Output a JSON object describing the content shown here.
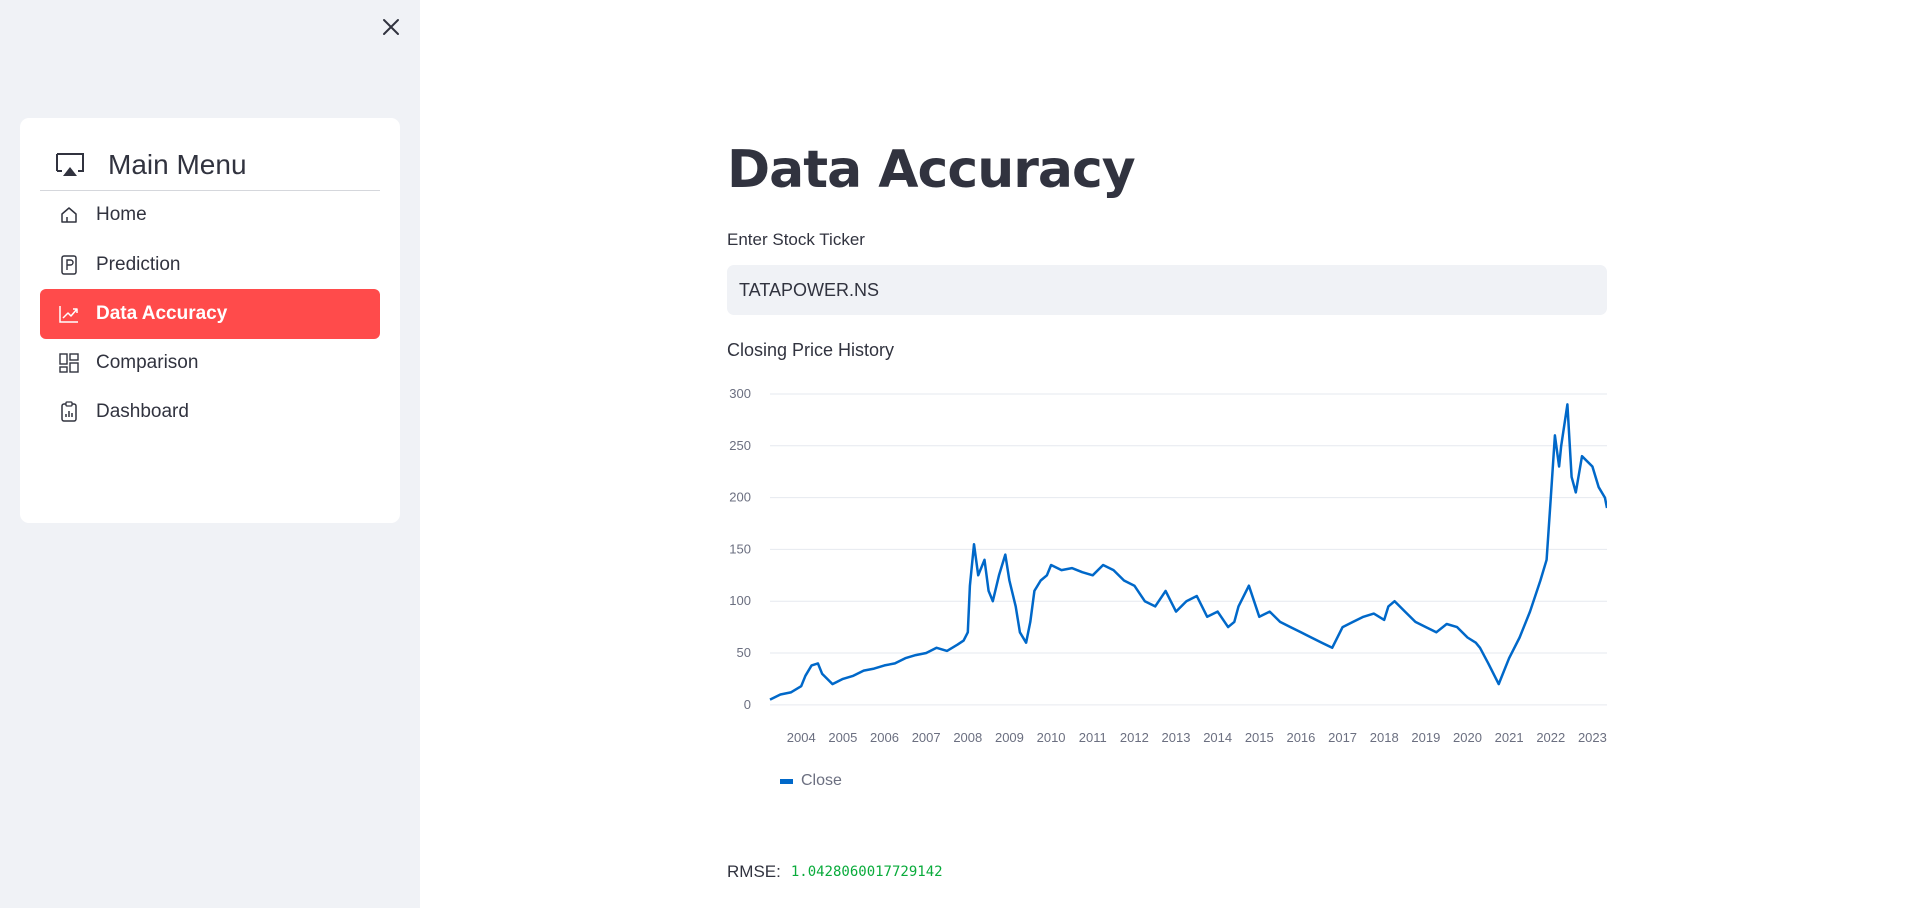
{
  "sidebar": {
    "menu_title": "Main Menu",
    "items": [
      {
        "label": "Home",
        "icon": "house-icon",
        "active": false
      },
      {
        "label": "Prediction",
        "icon": "p-square-icon",
        "active": false
      },
      {
        "label": "Data Accuracy",
        "icon": "graph-up-icon",
        "active": true
      },
      {
        "label": "Comparison",
        "icon": "grid-icon",
        "active": false
      },
      {
        "label": "Dashboard",
        "icon": "clipboard-data-icon",
        "active": false
      }
    ]
  },
  "main": {
    "title": "Data Accuracy",
    "ticker_label": "Enter Stock Ticker",
    "ticker_value": "TATAPOWER.NS",
    "chart_title": "Closing Price History",
    "rmse_label": "RMSE:",
    "rmse_value": "1.0428060017729142"
  },
  "colors": {
    "accent": "#ff4b4b",
    "series": "#0068c9",
    "sidebar_bg": "#f0f2f6",
    "rmse": "#09ab3b"
  },
  "chart_data": {
    "type": "line",
    "title": "Closing Price History",
    "xlabel": "",
    "ylabel": "",
    "legend": "bottom-left",
    "grid": true,
    "xlim": [
      2003.25,
      2023.35
    ],
    "ylim": [
      -5,
      300
    ],
    "yticks": [
      0,
      50,
      100,
      150,
      200,
      250,
      300
    ],
    "xticks": [
      "2004",
      "2005",
      "2006",
      "2007",
      "2008",
      "2009",
      "2010",
      "2011",
      "2012",
      "2013",
      "2014",
      "2015",
      "2016",
      "2017",
      "2018",
      "2019",
      "2020",
      "2021",
      "2022",
      "2023"
    ],
    "series": [
      {
        "name": "Close",
        "x": [
          2003.25,
          2003.5,
          2003.75,
          2004.0,
          2004.1,
          2004.25,
          2004.4,
          2004.5,
          2004.75,
          2005.0,
          2005.25,
          2005.5,
          2005.75,
          2006.0,
          2006.25,
          2006.5,
          2006.75,
          2007.0,
          2007.25,
          2007.5,
          2007.75,
          2007.9,
          2008.0,
          2008.05,
          2008.15,
          2008.25,
          2008.4,
          2008.5,
          2008.6,
          2008.75,
          2008.9,
          2009.0,
          2009.15,
          2009.25,
          2009.4,
          2009.5,
          2009.6,
          2009.75,
          2009.9,
          2010.0,
          2010.25,
          2010.5,
          2010.75,
          2011.0,
          2011.25,
          2011.5,
          2011.75,
          2012.0,
          2012.25,
          2012.5,
          2012.75,
          2013.0,
          2013.25,
          2013.5,
          2013.75,
          2014.0,
          2014.25,
          2014.4,
          2014.5,
          2014.75,
          2015.0,
          2015.25,
          2015.5,
          2015.75,
          2016.0,
          2016.25,
          2016.5,
          2016.75,
          2017.0,
          2017.25,
          2017.5,
          2017.75,
          2018.0,
          2018.1,
          2018.25,
          2018.5,
          2018.75,
          2019.0,
          2019.25,
          2019.5,
          2019.75,
          2020.0,
          2020.2,
          2020.3,
          2020.5,
          2020.75,
          2021.0,
          2021.25,
          2021.5,
          2021.75,
          2021.9,
          2022.0,
          2022.1,
          2022.2,
          2022.25,
          2022.4,
          2022.5,
          2022.6,
          2022.75,
          2023.0,
          2023.15,
          2023.3,
          2023.35
        ],
        "values": [
          5,
          10,
          12,
          18,
          28,
          38,
          40,
          30,
          20,
          25,
          28,
          33,
          35,
          38,
          40,
          45,
          48,
          50,
          55,
          52,
          58,
          62,
          70,
          115,
          155,
          125,
          140,
          110,
          100,
          125,
          145,
          120,
          95,
          70,
          60,
          80,
          110,
          120,
          125,
          135,
          130,
          132,
          128,
          125,
          135,
          130,
          120,
          115,
          100,
          95,
          110,
          90,
          100,
          105,
          85,
          90,
          75,
          80,
          95,
          115,
          85,
          90,
          80,
          75,
          70,
          65,
          60,
          55,
          75,
          80,
          85,
          88,
          82,
          95,
          100,
          90,
          80,
          75,
          70,
          78,
          75,
          65,
          60,
          55,
          40,
          20,
          45,
          65,
          90,
          120,
          140,
          200,
          260,
          230,
          250,
          290,
          220,
          205,
          240,
          230,
          210,
          200,
          190
        ]
      }
    ]
  }
}
